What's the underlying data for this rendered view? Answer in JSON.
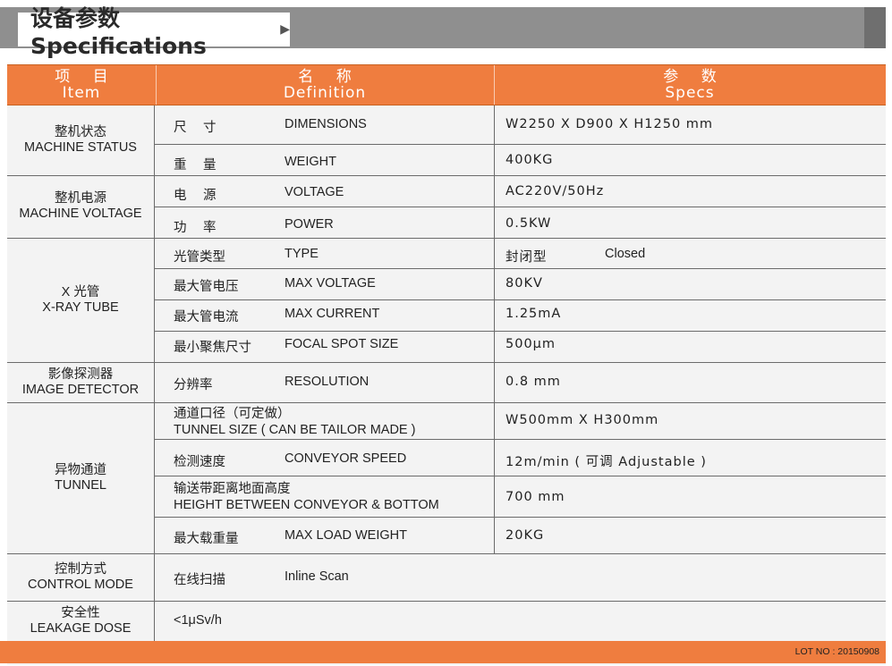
{
  "banner": {
    "title": "设备参数 Specifications",
    "arrow": "▶"
  },
  "header": {
    "item_cn": "项 目",
    "item_en": "Item",
    "def_cn": "名 称",
    "def_en": "Definition",
    "spec_cn": "参 数",
    "spec_en": "Specs"
  },
  "groups": [
    {
      "cn": "整机状态",
      "en": "MACHINE STATUS"
    },
    {
      "cn": "整机电源",
      "en": "MACHINE VOLTAGE"
    },
    {
      "cn": "X 光管",
      "en": "X-RAY TUBE"
    },
    {
      "cn": "影像探测器",
      "en": "IMAGE DETECTOR"
    },
    {
      "cn": "异物通道",
      "en": "TUNNEL"
    },
    {
      "cn": "控制方式",
      "en": "CONTROL MODE"
    },
    {
      "cn": "安全性",
      "en": "LEAKAGE DOSE"
    }
  ],
  "rows": [
    {
      "cn": "尺　 寸",
      "en": "DIMENSIONS",
      "spec": "W2250 X D900 X H1250 mm"
    },
    {
      "cn": "重　 量",
      "en": "WEIGHT",
      "spec": "400KG"
    },
    {
      "cn": "电　 源",
      "en": "VOLTAGE",
      "spec": "AC220V/50Hz"
    },
    {
      "cn": "功　 率",
      "en": "POWER",
      "spec": "0.5KW"
    },
    {
      "cn": "光管类型",
      "en": "TYPE",
      "spec": "封闭型",
      "spec_extra": "Closed"
    },
    {
      "cn": "最大管电压",
      "en": "MAX VOLTAGE",
      "spec": "80KV"
    },
    {
      "cn": "最大管电流",
      "en": "MAX CURRENT",
      "spec": "1.25mA"
    },
    {
      "cn": "最小聚焦尺寸",
      "en": "FOCAL SPOT SIZE",
      "spec": "500μm"
    },
    {
      "cn": "分辨率",
      "en": "RESOLUTION",
      "spec": "0.8 mm"
    },
    {
      "cn": "通道口径（可定做）",
      "en": "TUNNEL SIZE ( CAN BE TAILOR MADE )",
      "spec": "W500mm X H300mm"
    },
    {
      "cn": "检测速度",
      "en": "CONVEYOR SPEED",
      "spec": "12m/min ( 可调  Adjustable )"
    },
    {
      "cn": "输送带距离地面高度",
      "en": "HEIGHT BETWEEN CONVEYOR & BOTTOM",
      "spec": "700 mm"
    },
    {
      "cn": "最大载重量",
      "en": "MAX LOAD WEIGHT",
      "spec": "20KG"
    },
    {
      "cn": "在线扫描",
      "en": "Inline Scan"
    },
    {
      "cn": "<1μSv/h"
    }
  ],
  "footer": {
    "lot": "LOT NO : 20150908"
  }
}
